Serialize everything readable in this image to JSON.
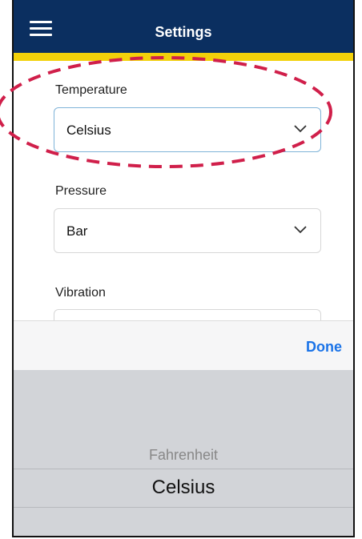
{
  "header": {
    "title": "Settings",
    "menu_icon": "hamburger-menu-icon",
    "background": "#0b2f60",
    "accent": "#f2d10a"
  },
  "fields": [
    {
      "label": "Temperature",
      "value": "Celsius",
      "highlighted": true
    },
    {
      "label": "Pressure",
      "value": "Bar"
    },
    {
      "label": "Vibration",
      "value": ""
    }
  ],
  "picker": {
    "done_label": "Done",
    "options": [
      "Fahrenheit",
      "Celsius"
    ],
    "selected": "Celsius"
  },
  "colors": {
    "done_link": "#1a73e8",
    "highlight_outline": "#d01f4a"
  }
}
